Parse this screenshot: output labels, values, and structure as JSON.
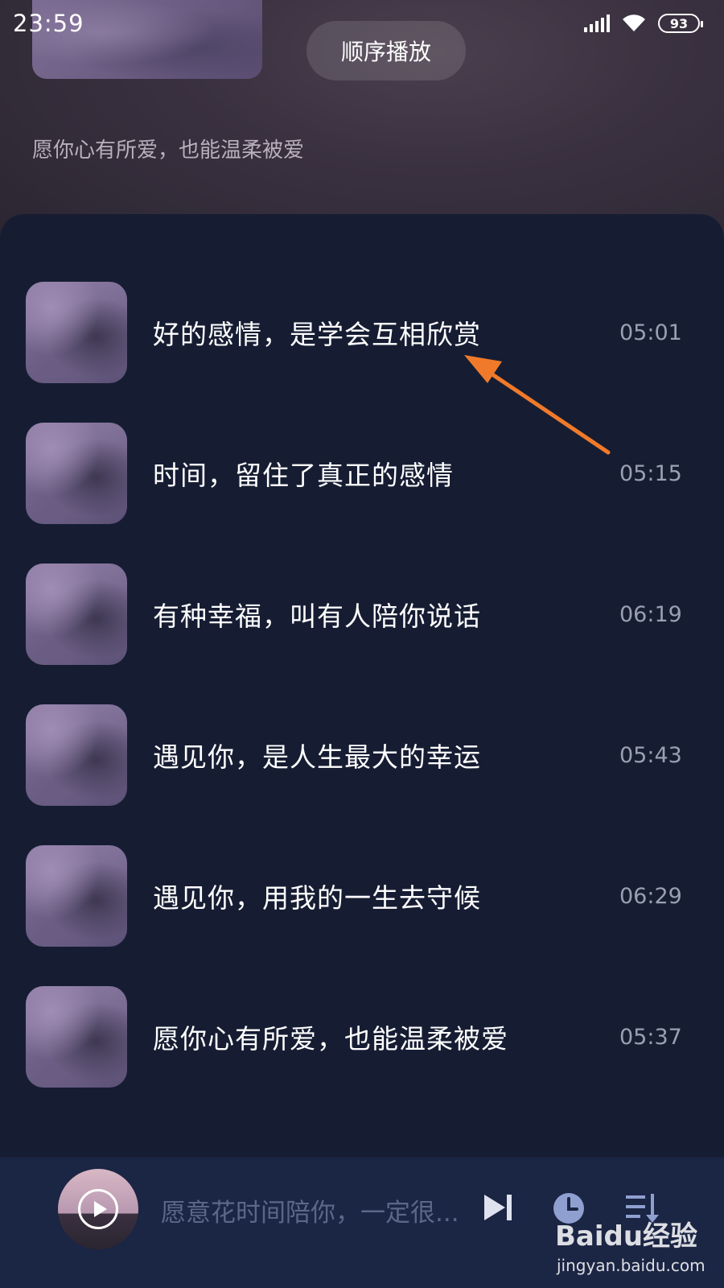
{
  "status_bar": {
    "time": "23:59",
    "battery": "93",
    "icons": [
      "signal-icon",
      "wifi-icon",
      "battery-icon"
    ]
  },
  "header": {
    "order_button": "顺序播放",
    "subtitle": "愿你心有所爱，也能温柔被爱"
  },
  "songs": [
    {
      "title": "好的感情，是学会互相欣赏",
      "duration": "05:01"
    },
    {
      "title": "时间，留住了真正的感情",
      "duration": "05:15"
    },
    {
      "title": "有种幸福，叫有人陪你说话",
      "duration": "06:19"
    },
    {
      "title": "遇见你，是人生最大的幸运",
      "duration": "05:43"
    },
    {
      "title": "遇见你，用我的一生去守候",
      "duration": "06:29"
    },
    {
      "title": "愿你心有所爱，也能温柔被爱",
      "duration": "05:37"
    }
  ],
  "player": {
    "now_playing": "愿意花时间陪你，一定很...",
    "icons": [
      "play-icon",
      "next-icon",
      "clock-icon",
      "playlist-icon"
    ]
  },
  "watermark": {
    "logo": "Baidu经验",
    "site": "jingyan.baidu.com"
  },
  "colors": {
    "background": "#161d33",
    "player_bg": "#1b2544",
    "arrow": "#f07a2a"
  }
}
